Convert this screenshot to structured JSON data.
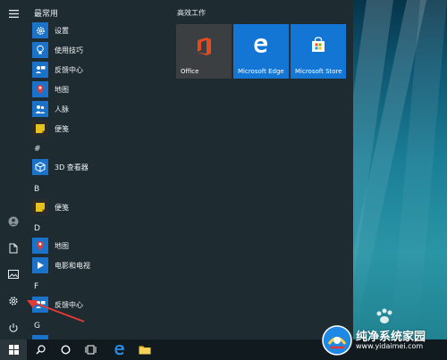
{
  "start_menu": {
    "frequent_header": "最常用",
    "frequent_apps": [
      {
        "label": "设置",
        "icon": "gear-icon",
        "color": "#1a73c9"
      },
      {
        "label": "使用技巧",
        "icon": "lightbulb-icon",
        "color": "#1a73c9"
      },
      {
        "label": "反馈中心",
        "icon": "feedback-icon",
        "color": "#1a73c9"
      },
      {
        "label": "地图",
        "icon": "map-pin-icon",
        "color": "#1a73c9"
      },
      {
        "label": "人脉",
        "icon": "people-icon",
        "color": "#1a73c9"
      },
      {
        "label": "便笺",
        "icon": "sticky-note-icon",
        "color": "#e8c21c"
      }
    ],
    "sections": [
      {
        "letter": "#",
        "apps": [
          {
            "label": "3D 查看器",
            "icon": "cube-icon",
            "color": "#1a73c9"
          }
        ]
      },
      {
        "letter": "B",
        "apps": [
          {
            "label": "便笺",
            "icon": "sticky-note-icon",
            "color": "#e8c21c"
          }
        ]
      },
      {
        "letter": "D",
        "apps": [
          {
            "label": "地图",
            "icon": "map-pin-icon",
            "color": "#1a73c9"
          },
          {
            "label": "电影和电视",
            "icon": "play-icon",
            "color": "#1a73c9"
          }
        ]
      },
      {
        "letter": "F",
        "apps": [
          {
            "label": "反馈中心",
            "icon": "feedback-icon",
            "color": "#1a73c9"
          }
        ]
      },
      {
        "letter": "G",
        "apps": []
      }
    ]
  },
  "tiles": {
    "group_title": "高效工作",
    "items": [
      {
        "label": "Office",
        "icon": "office-icon",
        "color": "#3b3f42"
      },
      {
        "label": "Microsoft Edge",
        "icon": "edge-icon",
        "color": "#1476d4"
      },
      {
        "label": "Microsoft Store",
        "icon": "store-icon",
        "color": "#1476d4"
      }
    ]
  },
  "watermark": {
    "title": "纯净系统家园",
    "url": "www.yidaimei.com"
  },
  "colors": {
    "accent": "#1a73c9",
    "menu_bg": "#1e2b31",
    "taskbar_bg": "#101a1f",
    "arrow": "#e53935"
  }
}
